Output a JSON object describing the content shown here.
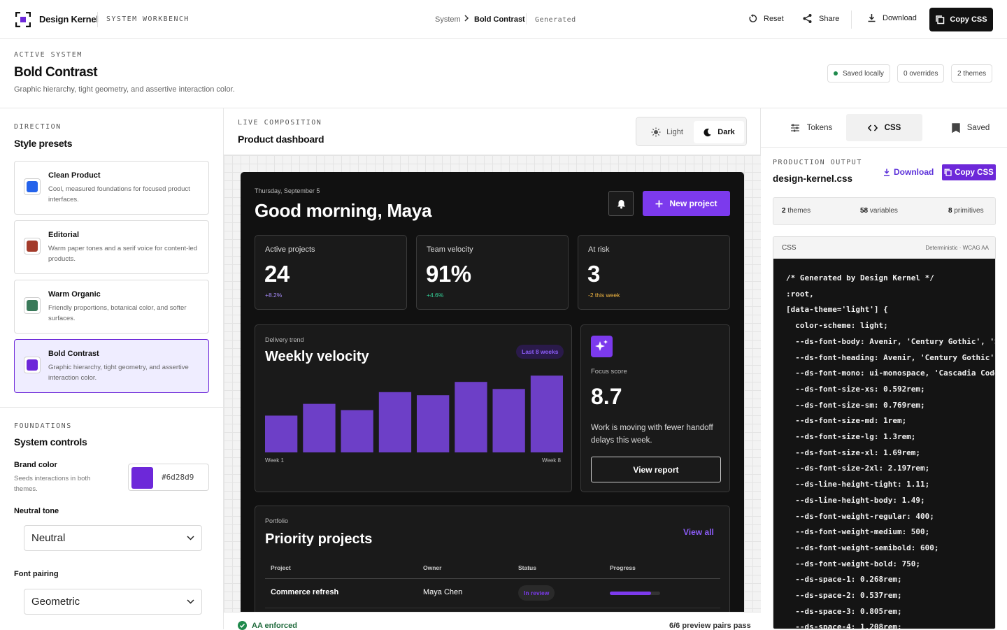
{
  "topbar": {
    "brand": "Design Kernel",
    "workbench": "SYSTEM WORKBENCH",
    "breadcrumb": {
      "root": "System",
      "current": "Bold Contrast",
      "status": "Generated"
    },
    "actions": {
      "reset": "Reset",
      "share": "Share",
      "download": "Download",
      "copy_css": "Copy CSS"
    }
  },
  "header": {
    "kicker": "ACTIVE SYSTEM",
    "title": "Bold Contrast",
    "description": "Graphic hierarchy, tight geometry, and assertive interaction color.",
    "pills": {
      "saved": "Saved locally",
      "overrides": "0 overrides",
      "themes": "2 themes"
    }
  },
  "left": {
    "direction_label": "DIRECTION",
    "presets_title": "Style presets",
    "presets": [
      {
        "name": "Clean Product",
        "desc": "Cool, measured foundations for focused product interfaces.",
        "color": "#2563eb"
      },
      {
        "name": "Editorial",
        "desc": "Warm paper tones and a serif voice for content-led products.",
        "color": "#a33b2b"
      },
      {
        "name": "Warm Organic",
        "desc": "Friendly proportions, botanical color, and softer surfaces.",
        "color": "#3a7a5a"
      },
      {
        "name": "Bold Contrast",
        "desc": "Graphic hierarchy, tight geometry, and assertive interaction color.",
        "color": "#6d28d9"
      }
    ],
    "selected_preset": "Bold Contrast",
    "foundations_label": "FOUNDATIONS",
    "controls_title": "System controls",
    "brand_color": {
      "label": "Brand color",
      "help": "Seeds interactions in both themes.",
      "value": "#6d28d9"
    },
    "neutral": {
      "label": "Neutral tone",
      "value": "Neutral"
    },
    "font": {
      "label": "Font pairing",
      "value": "Geometric"
    }
  },
  "center": {
    "kicker": "LIVE COMPOSITION",
    "title": "Product dashboard",
    "toggle": {
      "light": "Light",
      "dark": "Dark",
      "active": "Dark"
    },
    "footer": {
      "aa": "AA enforced",
      "pairs": "6/6 preview pairs pass"
    }
  },
  "preview": {
    "date": "Thursday, September 5",
    "greeting": "Good morning, Maya",
    "new_project": "New project",
    "stats": [
      {
        "label": "Active projects",
        "value": "24",
        "delta": "+8.2%",
        "delta_color": "#a78bfa"
      },
      {
        "label": "Team velocity",
        "value": "91%",
        "delta": "+4.6%",
        "delta_color": "#34d399"
      },
      {
        "label": "At risk",
        "value": "3",
        "delta": "-2 this week",
        "delta_color": "#f5b942"
      }
    ],
    "velocity": {
      "kicker": "Delivery trend",
      "title": "Weekly velocity",
      "badge": "Last 8 weeks",
      "x_start": "Week 1",
      "x_end": "Week 8"
    },
    "focus": {
      "label": "Focus score",
      "score": "8.7",
      "text": "Work is moving with fewer handoff delays this week.",
      "button": "View report"
    },
    "portfolio": {
      "kicker": "Portfolio",
      "title": "Priority projects",
      "view_all": "View all",
      "headers": [
        "Project",
        "Owner",
        "Status",
        "Progress"
      ],
      "rows": [
        {
          "project": "Commerce refresh",
          "owner": "Maya Chen",
          "status": "In review",
          "progress": 0.82
        }
      ]
    }
  },
  "chart_data": {
    "type": "bar",
    "categories": [
      "Week 1",
      "Week 2",
      "Week 3",
      "Week 4",
      "Week 5",
      "Week 6",
      "Week 7",
      "Week 8"
    ],
    "values": [
      47,
      62,
      54,
      77,
      73,
      90,
      81,
      98
    ],
    "ylim": [
      0,
      100
    ],
    "color": "#6d3fc7",
    "grid": false
  },
  "right": {
    "tabs": {
      "tokens": "Tokens",
      "css": "CSS",
      "saved": "Saved",
      "active": "CSS"
    },
    "kicker": "PRODUCTION OUTPUT",
    "file": "design-kernel.css",
    "download": "Download",
    "copy": "Copy CSS",
    "stats": [
      {
        "num": "2",
        "label": "themes"
      },
      {
        "num": "58",
        "label": "variables"
      },
      {
        "num": "8",
        "label": "primitives"
      }
    ],
    "code_lang": "CSS",
    "code_meta": "Deterministic · WCAG AA",
    "code_lines": [
      "/* Generated by Design Kernel */",
      ":root,",
      "[data-theme='light'] {",
      "  color-scheme: light;",
      "  --ds-font-body: Avenir, 'Century Gothic', 'Se",
      "  --ds-font-heading: Avenir, 'Century Gothic',",
      "  --ds-font-mono: ui-monospace, 'Cascadia Code'",
      "  --ds-font-size-xs: 0.592rem;",
      "  --ds-font-size-sm: 0.769rem;",
      "  --ds-font-size-md: 1rem;",
      "  --ds-font-size-lg: 1.3rem;",
      "  --ds-font-size-xl: 1.69rem;",
      "  --ds-font-size-2xl: 2.197rem;",
      "  --ds-line-height-tight: 1.11;",
      "  --ds-line-height-body: 1.49;",
      "  --ds-font-weight-regular: 400;",
      "  --ds-font-weight-medium: 500;",
      "  --ds-font-weight-semibold: 600;",
      "  --ds-font-weight-bold: 750;",
      "  --ds-space-1: 0.268rem;",
      "  --ds-space-2: 0.537rem;",
      "  --ds-space-3: 0.805rem;",
      "  --ds-space-4: 1.208rem;"
    ]
  }
}
